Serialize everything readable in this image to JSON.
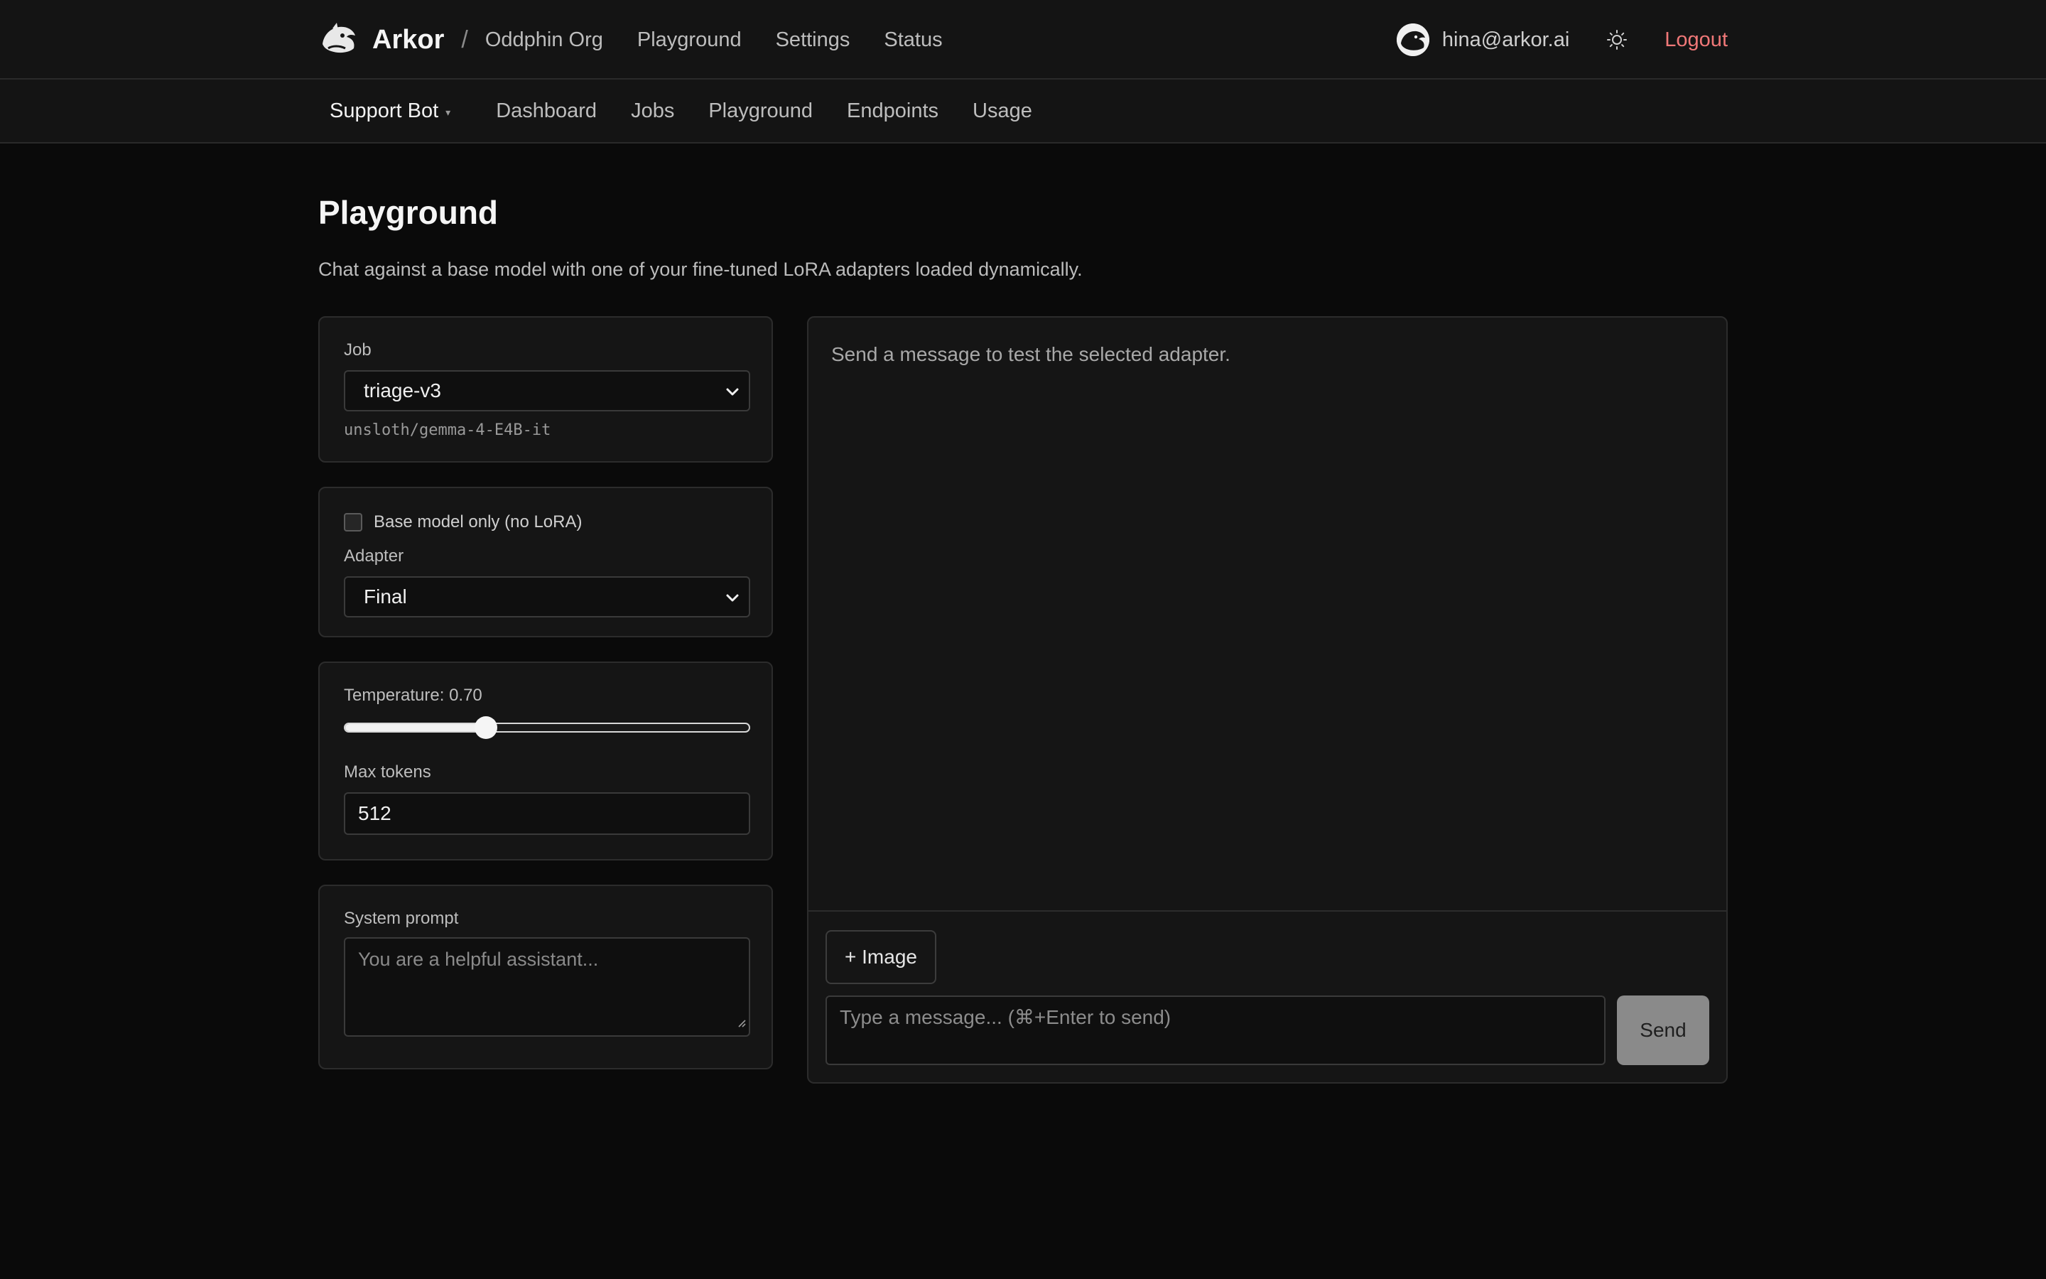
{
  "header": {
    "brand": "Arkor",
    "separator": "/",
    "org": "Oddphin Org",
    "nav": [
      "Playground",
      "Settings",
      "Status"
    ],
    "user_email": "hina@arkor.ai",
    "logout_label": "Logout"
  },
  "subheader": {
    "project": "Support Bot",
    "caret": "▾",
    "nav": [
      "Dashboard",
      "Jobs",
      "Playground",
      "Endpoints",
      "Usage"
    ]
  },
  "page": {
    "title": "Playground",
    "description": "Chat against a base model with one of your fine-tuned LoRA adapters loaded dynamically."
  },
  "job_card": {
    "label": "Job",
    "selected": "triage-v3",
    "model": "unsloth/gemma-4-E4B-it"
  },
  "adapter_card": {
    "base_only_label": "Base model only (no LoRA)",
    "base_only_checked": false,
    "adapter_label": "Adapter",
    "adapter_selected": "Final"
  },
  "params_card": {
    "temperature_label": "Temperature: 0.70",
    "temperature_value": 0.7,
    "temperature_max": 2.0,
    "max_tokens_label": "Max tokens",
    "max_tokens_value": "512"
  },
  "system_card": {
    "label": "System prompt",
    "placeholder": "You are a helpful assistant..."
  },
  "chat": {
    "empty_text": "Send a message to test the selected adapter.",
    "image_button": "+ Image",
    "input_placeholder": "Type a message... (⌘+Enter to send)",
    "send_label": "Send"
  },
  "colors": {
    "background": "#0a0a0a",
    "panel": "#151515",
    "logout": "#f07878",
    "send_button": "#8a8a8a"
  },
  "icons": {
    "logo": "dolphin-logo-icon",
    "avatar": "dolphin-avatar-icon",
    "theme": "sun-icon",
    "select": "chevron-down-icon",
    "resize": "resize-grip-icon"
  }
}
